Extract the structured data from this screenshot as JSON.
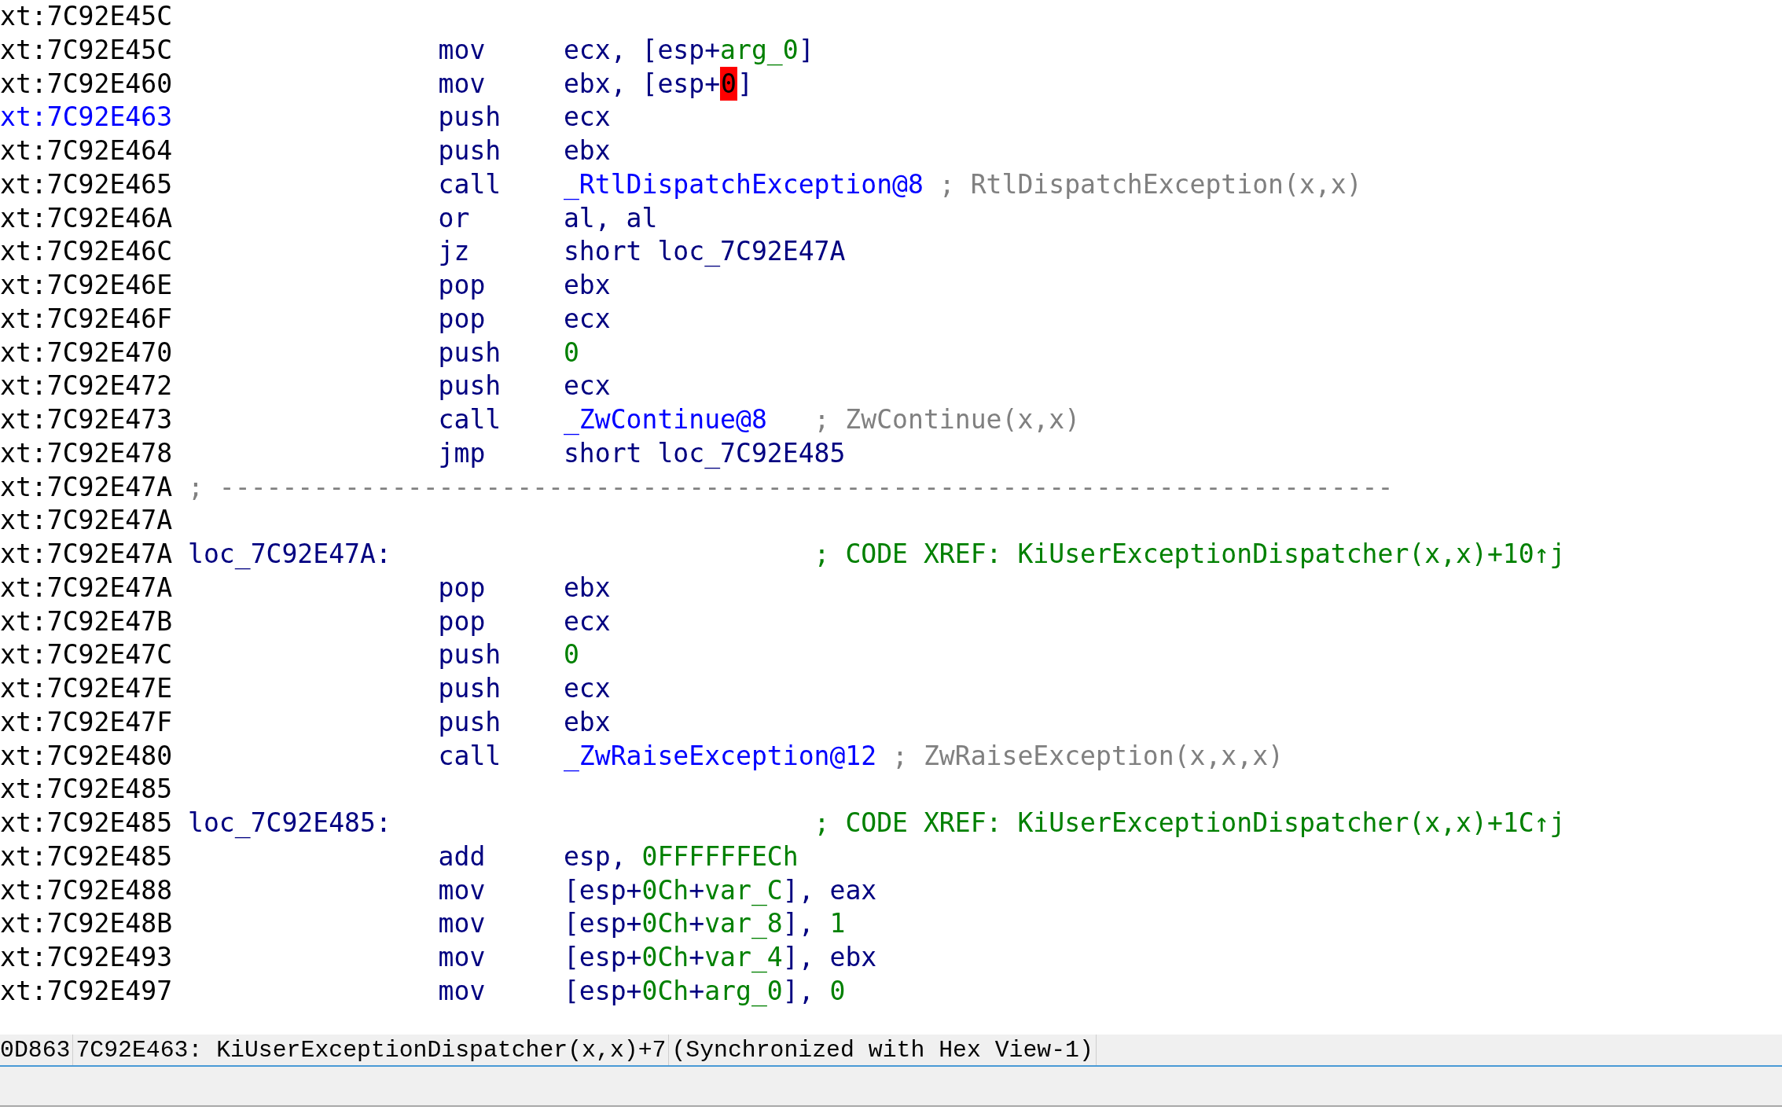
{
  "listing": {
    "lines": [
      {
        "kind": "blank",
        "address": "xt:7C92E45C",
        "current": false
      },
      {
        "kind": "instruction",
        "address": "xt:7C92E45C",
        "current": false,
        "mnemonic": "mov",
        "operands": [
          {
            "text": "ecx, [esp+",
            "kind": "plain"
          },
          {
            "text": "arg_0",
            "kind": "variable"
          },
          {
            "text": "]",
            "kind": "plain"
          }
        ]
      },
      {
        "kind": "instruction",
        "address": "xt:7C92E460",
        "current": false,
        "mnemonic": "mov",
        "operands": [
          {
            "text": "ebx, [esp+",
            "kind": "plain"
          },
          {
            "text": "0",
            "kind": "marked"
          },
          {
            "text": "]",
            "kind": "plain"
          }
        ]
      },
      {
        "kind": "instruction",
        "address": "xt:7C92E463",
        "current": true,
        "mnemonic": "push",
        "operands": [
          {
            "text": "ecx",
            "kind": "plain"
          }
        ]
      },
      {
        "kind": "instruction",
        "address": "xt:7C92E464",
        "current": false,
        "mnemonic": "push",
        "operands": [
          {
            "text": "ebx",
            "kind": "plain"
          }
        ]
      },
      {
        "kind": "instruction",
        "address": "xt:7C92E465",
        "current": false,
        "mnemonic": "call",
        "operands": [
          {
            "text": "_RtlDispatchException@8",
            "kind": "name"
          }
        ],
        "comment": {
          "text": "; RtlDispatchException(x,x)",
          "kind": "auto"
        }
      },
      {
        "kind": "instruction",
        "address": "xt:7C92E46A",
        "current": false,
        "mnemonic": "or",
        "operands": [
          {
            "text": "al, al",
            "kind": "plain"
          }
        ]
      },
      {
        "kind": "instruction",
        "address": "xt:7C92E46C",
        "current": false,
        "mnemonic": "jz",
        "operands": [
          {
            "text": "short loc_7C92E47A",
            "kind": "plain"
          }
        ]
      },
      {
        "kind": "instruction",
        "address": "xt:7C92E46E",
        "current": false,
        "mnemonic": "pop",
        "operands": [
          {
            "text": "ebx",
            "kind": "plain"
          }
        ]
      },
      {
        "kind": "instruction",
        "address": "xt:7C92E46F",
        "current": false,
        "mnemonic": "pop",
        "operands": [
          {
            "text": "ecx",
            "kind": "plain"
          }
        ]
      },
      {
        "kind": "instruction",
        "address": "xt:7C92E470",
        "current": false,
        "mnemonic": "push",
        "operands": [
          {
            "text": "0",
            "kind": "number"
          }
        ]
      },
      {
        "kind": "instruction",
        "address": "xt:7C92E472",
        "current": false,
        "mnemonic": "push",
        "operands": [
          {
            "text": "ecx",
            "kind": "plain"
          }
        ]
      },
      {
        "kind": "instruction",
        "address": "xt:7C92E473",
        "current": false,
        "mnemonic": "call",
        "operands": [
          {
            "text": "_ZwContinue@8",
            "kind": "name"
          }
        ],
        "comment": {
          "text": "; ZwContinue(x,x)",
          "kind": "auto"
        }
      },
      {
        "kind": "instruction",
        "address": "xt:7C92E478",
        "current": false,
        "mnemonic": "jmp",
        "operands": [
          {
            "text": "short loc_7C92E485",
            "kind": "plain"
          }
        ]
      },
      {
        "kind": "separator",
        "address": "xt:7C92E47A",
        "current": false,
        "text": "; ---------------------------------------------------------------------------"
      },
      {
        "kind": "blank",
        "address": "xt:7C92E47A",
        "current": false
      },
      {
        "kind": "label",
        "address": "xt:7C92E47A",
        "current": false,
        "label": "loc_7C92E47A:",
        "comment": {
          "text": "; CODE XREF: KiUserExceptionDispatcher(x,x)+10↑j",
          "kind": "xref"
        }
      },
      {
        "kind": "instruction",
        "address": "xt:7C92E47A",
        "current": false,
        "mnemonic": "pop",
        "operands": [
          {
            "text": "ebx",
            "kind": "plain"
          }
        ]
      },
      {
        "kind": "instruction",
        "address": "xt:7C92E47B",
        "current": false,
        "mnemonic": "pop",
        "operands": [
          {
            "text": "ecx",
            "kind": "plain"
          }
        ]
      },
      {
        "kind": "instruction",
        "address": "xt:7C92E47C",
        "current": false,
        "mnemonic": "push",
        "operands": [
          {
            "text": "0",
            "kind": "number"
          }
        ]
      },
      {
        "kind": "instruction",
        "address": "xt:7C92E47E",
        "current": false,
        "mnemonic": "push",
        "operands": [
          {
            "text": "ecx",
            "kind": "plain"
          }
        ]
      },
      {
        "kind": "instruction",
        "address": "xt:7C92E47F",
        "current": false,
        "mnemonic": "push",
        "operands": [
          {
            "text": "ebx",
            "kind": "plain"
          }
        ]
      },
      {
        "kind": "instruction",
        "address": "xt:7C92E480",
        "current": false,
        "mnemonic": "call",
        "operands": [
          {
            "text": "_ZwRaiseException@12",
            "kind": "name"
          }
        ],
        "comment": {
          "text": "; ZwRaiseException(x,x,x)",
          "kind": "auto"
        }
      },
      {
        "kind": "blank",
        "address": "xt:7C92E485",
        "current": false
      },
      {
        "kind": "label",
        "address": "xt:7C92E485",
        "current": false,
        "label": "loc_7C92E485:",
        "comment": {
          "text": "; CODE XREF: KiUserExceptionDispatcher(x,x)+1C↑j",
          "kind": "xref"
        }
      },
      {
        "kind": "instruction",
        "address": "xt:7C92E485",
        "current": false,
        "mnemonic": "add",
        "operands": [
          {
            "text": "esp, ",
            "kind": "plain"
          },
          {
            "text": "0FFFFFFECh",
            "kind": "number"
          }
        ]
      },
      {
        "kind": "instruction",
        "address": "xt:7C92E488",
        "current": false,
        "mnemonic": "mov",
        "operands": [
          {
            "text": "[esp+",
            "kind": "plain"
          },
          {
            "text": "0Ch",
            "kind": "number"
          },
          {
            "text": "+",
            "kind": "plain"
          },
          {
            "text": "var_C",
            "kind": "variable"
          },
          {
            "text": "], eax",
            "kind": "plain"
          }
        ]
      },
      {
        "kind": "instruction",
        "address": "xt:7C92E48B",
        "current": false,
        "mnemonic": "mov",
        "operands": [
          {
            "text": "[esp+",
            "kind": "plain"
          },
          {
            "text": "0Ch",
            "kind": "number"
          },
          {
            "text": "+",
            "kind": "plain"
          },
          {
            "text": "var_8",
            "kind": "variable"
          },
          {
            "text": "], ",
            "kind": "plain"
          },
          {
            "text": "1",
            "kind": "number"
          }
        ]
      },
      {
        "kind": "instruction",
        "address": "xt:7C92E493",
        "current": false,
        "mnemonic": "mov",
        "operands": [
          {
            "text": "[esp+",
            "kind": "plain"
          },
          {
            "text": "0Ch",
            "kind": "number"
          },
          {
            "text": "+",
            "kind": "plain"
          },
          {
            "text": "var_4",
            "kind": "variable"
          },
          {
            "text": "], ebx",
            "kind": "plain"
          }
        ]
      },
      {
        "kind": "instruction",
        "address": "xt:7C92E497",
        "current": false,
        "mnemonic": "mov",
        "operands": [
          {
            "text": "[esp+",
            "kind": "plain"
          },
          {
            "text": "0Ch",
            "kind": "number"
          },
          {
            "text": "+",
            "kind": "plain"
          },
          {
            "text": "arg_0",
            "kind": "variable"
          },
          {
            "text": "], ",
            "kind": "plain"
          },
          {
            "text": "0",
            "kind": "number"
          }
        ]
      }
    ]
  },
  "status_bar": {
    "offset": "0D863",
    "location": "7C92E463: KiUserExceptionDispatcher(x,x)+7",
    "sync": "(Synchronized with Hex View-1)"
  }
}
